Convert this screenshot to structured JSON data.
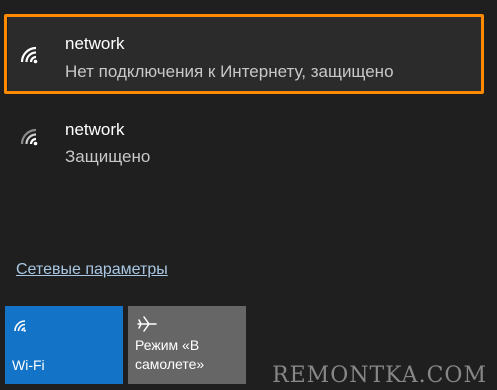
{
  "networks": [
    {
      "name": "network",
      "status": "Нет подключения к Интернету, защищено",
      "selected": true
    },
    {
      "name": "network",
      "status": "Защищено",
      "selected": false
    }
  ],
  "settings_link": "Сетевые параметры",
  "tiles": {
    "wifi": {
      "label": "Wi-Fi",
      "icon": "wifi-icon",
      "color": "#1273c7"
    },
    "airplane": {
      "label": "Режим «В самолете»",
      "icon": "airplane-icon",
      "color": "#666666"
    }
  },
  "highlight_color": "#ff8a00",
  "watermark": "REMONTKA.COM"
}
